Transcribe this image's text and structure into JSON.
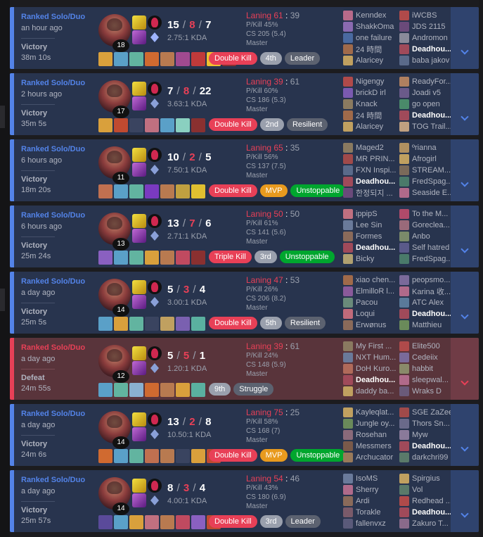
{
  "colors": {
    "win": "#5383e8",
    "loss": "#e84057",
    "badge_kill": "#e84057",
    "badge_rank": "#9aa0ad",
    "badge_mvp": "#e89a1e",
    "badge_unstoppable": "#00a62e",
    "badge_gray": "#5c6270"
  },
  "matches": [
    {
      "result_class": "win",
      "queue": "Ranked Solo/Duo",
      "ago": "an hour ago",
      "result": "Victory",
      "duration": "38m 10s",
      "level": "18",
      "kills": "15",
      "deaths": "8",
      "assists": "7",
      "kda_ratio": "2.75:1 KDA",
      "rune_style": "sorc",
      "items": [
        "#d9a03c",
        "#5aa0c8",
        "#62b4a0",
        "#d06a30",
        "#b87a50",
        "#a04a90",
        "#c03a3a",
        "#f0c030",
        "#8a3030"
      ],
      "laning": "Laning 61",
      "laning_opp": "39",
      "pkill": "P/Kill 45%",
      "cs": "CS 205 (5.4)",
      "tier": "Master",
      "badges": [
        {
          "text": "Double Kill",
          "color": "#e84057"
        },
        {
          "text": "4th",
          "color": "#9aa0ad"
        },
        {
          "text": "Leader",
          "color": "#5c6270"
        }
      ],
      "team_a": [
        {
          "name": "Kenndex",
          "pic": "#b86a8a",
          "me": false
        },
        {
          "name": "ShakkOma",
          "pic": "#8a6ab0",
          "me": false
        },
        {
          "name": "one failure",
          "pic": "#4a6aa0",
          "me": false
        },
        {
          "name": "24 時間",
          "pic": "#a06a4a",
          "me": false
        },
        {
          "name": "Alaricey",
          "pic": "#c0a060",
          "me": false
        }
      ],
      "team_b": [
        {
          "name": "iWCBS",
          "pic": "#b04a4a",
          "me": false
        },
        {
          "name": "JDS 2115",
          "pic": "#6a4a7a",
          "me": false
        },
        {
          "name": "Andromon",
          "pic": "#8a8a9a",
          "me": false
        },
        {
          "name": "Deadhou...",
          "pic": "#a04a5a",
          "me": true
        },
        {
          "name": "baba jakov",
          "pic": "#5a6a8a",
          "me": false
        }
      ]
    },
    {
      "result_class": "win",
      "queue": "Ranked Solo/Duo",
      "ago": "2 hours ago",
      "result": "Victory",
      "duration": "35m 5s",
      "level": "17",
      "kills": "7",
      "deaths": "8",
      "assists": "22",
      "kda_ratio": "3.63:1 KDA",
      "rune_style": "",
      "items": [
        "#d9a03c",
        "#c04a30",
        "#3a4460",
        "#c07080",
        "#5aa0c8",
        "#8ad0c0",
        "#8a3030"
      ],
      "laning": "Laning 39",
      "laning_opp": "61",
      "pkill": "P/Kill 60%",
      "cs": "CS 186 (5.3)",
      "tier": "Master",
      "badges": [
        {
          "text": "Double Kill",
          "color": "#e84057"
        },
        {
          "text": "2nd",
          "color": "#9aa0ad"
        },
        {
          "text": "Resilient",
          "color": "#5c6270"
        }
      ],
      "team_a": [
        {
          "name": "Nigengy",
          "pic": "#b04a4a",
          "me": false
        },
        {
          "name": "brickD irl",
          "pic": "#7a5ab0",
          "me": false
        },
        {
          "name": "Knack",
          "pic": "#8a7a60",
          "me": false
        },
        {
          "name": "24 時間",
          "pic": "#a06a4a",
          "me": false
        },
        {
          "name": "Alaricey",
          "pic": "#c0a060",
          "me": false
        }
      ],
      "team_b": [
        {
          "name": "ReadyFor...",
          "pic": "#b08060",
          "me": false
        },
        {
          "name": "Joadi v5",
          "pic": "#6a5a8a",
          "me": false
        },
        {
          "name": "go open",
          "pic": "#4a8a6a",
          "me": false
        },
        {
          "name": "Deadhou...",
          "pic": "#a04a5a",
          "me": true
        },
        {
          "name": "TOG Trail...",
          "pic": "#c0a080",
          "me": false
        }
      ]
    },
    {
      "result_class": "win",
      "queue": "Ranked Solo/Duo",
      "ago": "6 hours ago",
      "result": "Victory",
      "duration": "18m 20s",
      "level": "11",
      "kills": "10",
      "deaths": "2",
      "assists": "5",
      "kda_ratio": "7.50:1 KDA",
      "rune_style": "",
      "items": [
        "#c07050",
        "#5aa0c8",
        "#62b4a0",
        "#7a3ac0",
        "#b87a50",
        "#c0a040",
        "#e0c030"
      ],
      "laning": "Laning 65",
      "laning_opp": "35",
      "pkill": "P/Kill 56%",
      "cs": "CS 137 (7.5)",
      "tier": "Master",
      "badges": [
        {
          "text": "Double Kill",
          "color": "#e84057"
        },
        {
          "text": "MVP",
          "color": "#e89a1e"
        },
        {
          "text": "Unstoppable",
          "color": "#00a62e"
        }
      ],
      "team_a": [
        {
          "name": "Maged2",
          "pic": "#8a7a60",
          "me": false
        },
        {
          "name": "MR PRIN...",
          "pic": "#a04a4a",
          "me": false
        },
        {
          "name": "FXN Inspi...",
          "pic": "#5a6a8a",
          "me": false
        },
        {
          "name": "Deadhou...",
          "pic": "#a04a5a",
          "me": true
        },
        {
          "name": "한정되지 ...",
          "pic": "#6a4a7a",
          "me": false
        }
      ],
      "team_b": [
        {
          "name": "ºrianna",
          "pic": "#b09060",
          "me": false
        },
        {
          "name": "Afrogirl",
          "pic": "#c0a060",
          "me": false
        },
        {
          "name": "STREAM...",
          "pic": "#7a6a5a",
          "me": false
        },
        {
          "name": "FredSpag...",
          "pic": "#4a7a6a",
          "me": false
        },
        {
          "name": "Seaside E...",
          "pic": "#b06a8a",
          "me": false
        }
      ]
    },
    {
      "result_class": "win",
      "queue": "Ranked Solo/Duo",
      "ago": "6 hours ago",
      "result": "Victory",
      "duration": "25m 24s",
      "level": "13",
      "kills": "13",
      "deaths": "7",
      "assists": "6",
      "kda_ratio": "2.71:1 KDA",
      "rune_style": "",
      "items": [
        "#8a60c0",
        "#5aa0c8",
        "#62b4a0",
        "#d9a03c",
        "#b87a50",
        "#c04a60",
        "#8a3030"
      ],
      "laning": "Laning 50",
      "laning_opp": "50",
      "pkill": "P/Kill 61%",
      "cs": "CS 141 (5.6)",
      "tier": "Master",
      "badges": [
        {
          "text": "Triple Kill",
          "color": "#e84057"
        },
        {
          "text": "3rd",
          "color": "#9aa0ad"
        },
        {
          "text": "Unstoppable",
          "color": "#00a62e"
        }
      ],
      "team_a": [
        {
          "name": "ippipS",
          "pic": "#c07080",
          "me": false
        },
        {
          "name": "Lee Sin",
          "pic": "#6a7a9a",
          "me": false
        },
        {
          "name": "Formes",
          "pic": "#8a6a5a",
          "me": false
        },
        {
          "name": "Deadhou...",
          "pic": "#a04a5a",
          "me": true
        },
        {
          "name": "Bicky",
          "pic": "#b0a070",
          "me": false
        }
      ],
      "team_b": [
        {
          "name": "To the M...",
          "pic": "#b04a6a",
          "me": false
        },
        {
          "name": "Gorecleа...",
          "pic": "#9a6a7a",
          "me": false
        },
        {
          "name": "Anbo",
          "pic": "#7a8a6a",
          "me": false
        },
        {
          "name": "Self hatred",
          "pic": "#5a5a8a",
          "me": false
        },
        {
          "name": "FredSpag...",
          "pic": "#4a7a6a",
          "me": false
        }
      ]
    },
    {
      "result_class": "win",
      "queue": "Ranked Solo/Duo",
      "ago": "a day ago",
      "result": "Victory",
      "duration": "25m 5s",
      "level": "14",
      "kills": "5",
      "deaths": "3",
      "assists": "4",
      "kda_ratio": "3.00:1 KDA",
      "rune_style": "",
      "items": [
        "#5aa0c8",
        "#d9a03c",
        "#62b4a0",
        "#3a4460",
        "#c0a060",
        "#7a60b0",
        "#5ab0a0"
      ],
      "laning": "Laning 47",
      "laning_opp": "53",
      "pkill": "P/Kill 26%",
      "cs": "CS 206 (8.2)",
      "tier": "Master",
      "badges": [
        {
          "text": "Double Kill",
          "color": "#e84057"
        },
        {
          "text": "5th",
          "color": "#9aa0ad"
        },
        {
          "text": "Resilient",
          "color": "#5c6270"
        }
      ],
      "team_a": [
        {
          "name": "xiao chen...",
          "pic": "#a06a4a",
          "me": false
        },
        {
          "name": "ElmilloR l...",
          "pic": "#8a5a9a",
          "me": false
        },
        {
          "name": "Pacou",
          "pic": "#6a8a7a",
          "me": false
        },
        {
          "name": "Loqui",
          "pic": "#c06a7a",
          "me": false
        },
        {
          "name": "Erwønus",
          "pic": "#8a6a5a",
          "me": false
        }
      ],
      "team_b": [
        {
          "name": "peopsmo...",
          "pic": "#7a6a9a",
          "me": false
        },
        {
          "name": "Karina 收...",
          "pic": "#b06a8a",
          "me": false
        },
        {
          "name": "ATC Alex",
          "pic": "#5a7a9a",
          "me": false
        },
        {
          "name": "Deadhou...",
          "pic": "#a04a5a",
          "me": true
        },
        {
          "name": "Matthieu",
          "pic": "#6a8a5a",
          "me": false
        }
      ]
    },
    {
      "result_class": "loss",
      "queue": "Ranked Solo/Duo",
      "ago": "a day ago",
      "result": "Defeat",
      "duration": "24m 55s",
      "level": "12",
      "kills": "5",
      "deaths": "5",
      "assists": "1",
      "kda_ratio": "1.20:1 KDA",
      "rune_style": "",
      "items": [
        "#5aa0c8",
        "#62b4a0",
        "#8ab0d0",
        "#d06a30",
        "#b87a50",
        "#d9a03c",
        "#5ab0a0"
      ],
      "laning": "Laning 39",
      "laning_opp": "61",
      "pkill": "P/Kill 24%",
      "cs": "CS 148 (5.9)",
      "tier": "Master",
      "badges": [
        {
          "text": "9th",
          "color": "#9aa0ad"
        },
        {
          "text": "Struggle",
          "color": "#5c6270"
        }
      ],
      "team_a": [
        {
          "name": "My First ...",
          "pic": "#8a7a60",
          "me": false
        },
        {
          "name": "NXT Hum...",
          "pic": "#6a7a9a",
          "me": false
        },
        {
          "name": "DoH Kuro...",
          "pic": "#b06a5a",
          "me": false
        },
        {
          "name": "Deadhou...",
          "pic": "#a04a5a",
          "me": true
        },
        {
          "name": "daddy ba...",
          "pic": "#c0a060",
          "me": false
        }
      ],
      "team_b": [
        {
          "name": "Elite500",
          "pic": "#b04a4a",
          "me": false
        },
        {
          "name": "Cedeiix",
          "pic": "#7a6a9a",
          "me": false
        },
        {
          "name": "habbit",
          "pic": "#8a8a6a",
          "me": false
        },
        {
          "name": "sleepwal...",
          "pic": "#b06a8a",
          "me": false
        },
        {
          "name": "Wraks D",
          "pic": "#6a5a7a",
          "me": false
        }
      ]
    },
    {
      "result_class": "win",
      "queue": "Ranked Solo/Duo",
      "ago": "a day ago",
      "result": "Victory",
      "duration": "24m 6s",
      "level": "14",
      "kills": "13",
      "deaths": "2",
      "assists": "8",
      "kda_ratio": "10.50:1 KDA",
      "rune_style": "",
      "items": [
        "#d06a30",
        "#5aa0c8",
        "#62b4a0",
        "#c07050",
        "#b87a50",
        "#3a4460",
        "#d9a03c",
        "#c04a30"
      ],
      "laning": "Laning 75",
      "laning_opp": "25",
      "pkill": "P/Kill 58%",
      "cs": "CS 168 (7)",
      "tier": "Master",
      "badges": [
        {
          "text": "Double Kill",
          "color": "#e84057"
        },
        {
          "text": "MVP",
          "color": "#e89a1e"
        },
        {
          "text": "Unstoppable",
          "color": "#00a62e"
        }
      ],
      "team_a": [
        {
          "name": "Kayleqlat...",
          "pic": "#c0a060",
          "me": false
        },
        {
          "name": "Jungle oy...",
          "pic": "#6a8a5a",
          "me": false
        },
        {
          "name": "Rosehan",
          "pic": "#8a6a7a",
          "me": false
        },
        {
          "name": "Messmers",
          "pic": "#7a5a4a",
          "me": false
        },
        {
          "name": "Archucator",
          "pic": "#9a7a5a",
          "me": false
        }
      ],
      "team_b": [
        {
          "name": "SGE ZaZee",
          "pic": "#a04a4a",
          "me": false
        },
        {
          "name": "Thors Sn...",
          "pic": "#6a6a8a",
          "me": false
        },
        {
          "name": "Myw",
          "pic": "#8a7a9a",
          "me": false
        },
        {
          "name": "Deadhou...",
          "pic": "#a04a5a",
          "me": true
        },
        {
          "name": "darkchri99",
          "pic": "#5a7a6a",
          "me": false
        }
      ]
    },
    {
      "result_class": "win",
      "queue": "Ranked Solo/Duo",
      "ago": "a day ago",
      "result": "Victory",
      "duration": "25m 57s",
      "level": "14",
      "kills": "8",
      "deaths": "3",
      "assists": "4",
      "kda_ratio": "4.00:1 KDA",
      "rune_style": "",
      "items": [
        "#5a4a9a",
        "#5aa0c8",
        "#d9a03c",
        "#c07080",
        "#b87a50",
        "#c04a60",
        "#8a60c0",
        "#c04a30"
      ],
      "laning": "Laning 54",
      "laning_opp": "46",
      "pkill": "P/Kill 43%",
      "cs": "CS 180 (6.9)",
      "tier": "Master",
      "badges": [
        {
          "text": "Double Kill",
          "color": "#e84057"
        },
        {
          "text": "3rd",
          "color": "#9aa0ad"
        },
        {
          "text": "Leader",
          "color": "#5c6270"
        }
      ],
      "team_a": [
        {
          "name": "IsoMS",
          "pic": "#6a7a9a",
          "me": false
        },
        {
          "name": "Sherry",
          "pic": "#b06a8a",
          "me": false
        },
        {
          "name": "Ardi",
          "pic": "#8a6a5a",
          "me": false
        },
        {
          "name": "Torakle",
          "pic": "#7a5a6a",
          "me": false
        },
        {
          "name": "fallenvxz",
          "pic": "#5a5a7a",
          "me": false
        }
      ],
      "team_b": [
        {
          "name": "Spirgius",
          "pic": "#c0a060",
          "me": false
        },
        {
          "name": "Vol",
          "pic": "#5a7a6a",
          "me": false
        },
        {
          "name": "Redhead ...",
          "pic": "#b04a4a",
          "me": false
        },
        {
          "name": "Deadhou...",
          "pic": "#a04a5a",
          "me": true
        },
        {
          "name": "Zakuro T...",
          "pic": "#8a6a8a",
          "me": false
        }
      ]
    }
  ]
}
